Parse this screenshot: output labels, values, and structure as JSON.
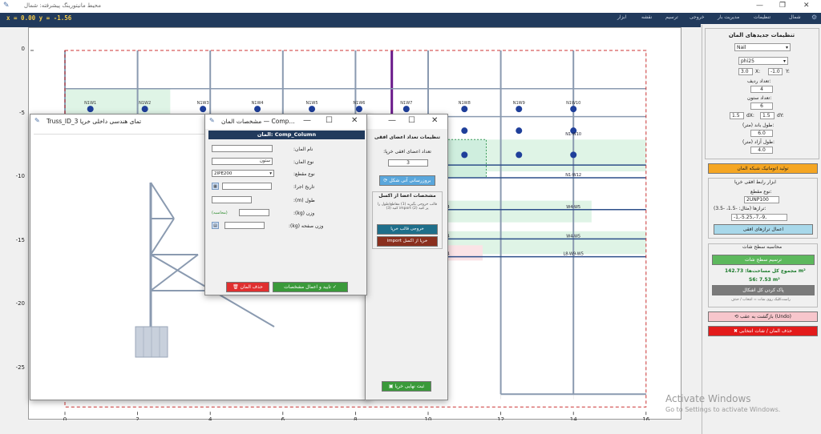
{
  "app": {
    "title": "محیط مانیتورینگ پیشرفته: شمال",
    "menu": [
      "شمال",
      "تنظیمات",
      "مدیریت بار",
      "خروجی",
      "ترسیم",
      "نقشه",
      "ابزار"
    ]
  },
  "coords": {
    "text": "x = 0.00    y = -1.56"
  },
  "plot": {
    "x_ticks": [
      "0",
      "2",
      "4",
      "6",
      "8",
      "10",
      "12",
      "14",
      "16"
    ],
    "y_ticks": [
      "0",
      "-5",
      "-10",
      "-15",
      "-20",
      "-25"
    ],
    "node_labels_row1": [
      "N1W1",
      "N1W2",
      "N1W3",
      "N1W4",
      "N1W5",
      "N1W6",
      "N1W7",
      "N1W8",
      "N1W9",
      "N1W10"
    ],
    "wall_labels": [
      "N1-W10",
      "N1-W12",
      "W4-W5",
      "W4-W5",
      "W4",
      "W4",
      "W4",
      "L8-W9-W5",
      "N1-W12",
      "N1-W10",
      "N1-W9",
      "N2-W3"
    ],
    "colors": {
      "grid_col": "#8a9ab0",
      "beam": "#2d4f8a",
      "node": "#1f3f9a",
      "purple": "#6a1a8a",
      "dash": "#cc3333",
      "green_fill": "#dff4e6",
      "pink_fill": "#fbe3e6"
    }
  },
  "right_panel": {
    "header": "تنظیمات جدیدهای المان",
    "type_select": "Nail",
    "size_select": "phi25",
    "x_val": "3.0",
    "x_lbl": "X:",
    "y_val": "-1.0",
    "y_lbl": "Y:",
    "rows_lbl": "تعداد ردیف:",
    "rows_val": "4",
    "cols_lbl": "تعداد ستون:",
    "cols_val": "6",
    "dx_val": "1.5",
    "dx_lbl": "dX:",
    "dy_val": "1.5",
    "dy_lbl": "dY:",
    "len_lbl": "طول باند (متر):",
    "len_val": "6.0",
    "free_lbl": "طول آزاد (متر):",
    "free_val": "4.0",
    "generate_btn": "تولید اتوماتیک شبکه المان",
    "strut_title": "ابزار رابط افقی خرپا",
    "section_lbl": "نوع مقطع:",
    "section_val": "2UNP100",
    "levels_lbl": "ترازها (مثال: -1.5، -3.5):",
    "levels_val": "-1,-5.25,-7,-9,",
    "apply_btn": "اعمال ترازهای افقی",
    "area_title": "محاسبه سطح شات",
    "draw_area_btn": "ترسیم سطح شات",
    "total_area": "مجموع کل مساحت‌ها: 142.73 m²",
    "s6_area": "S6: 7.53 m²",
    "clear_btn": "پاک کردن کل اشکال",
    "hint": "راست‌کلیک روی شات = انتخاب / حذف",
    "undo_btn": "بازگشت به عقب (Undo)",
    "delete_btn": "حذف المان / شات انتخابی",
    "colors": {
      "generate": "#f5a623",
      "apply": "#a8d8ea",
      "draw": "#5cb85c",
      "clear": "#7a7a7a",
      "undo": "#f7c6cc",
      "delete": "#e31b1b"
    }
  },
  "truss_window": {
    "title": "Truss_ID_3  تمای هندسی داخلی خرپا"
  },
  "horiz_window": {
    "header": "تنظیمات تعداد اعضای افقی",
    "count_lbl": "تعداد اعضای افقی خرپا:",
    "count_val": "3",
    "update_btn": "بروزرسانی آنی شکل",
    "excel_title": "مشخصات اعضا از اکسل",
    "excel_note": "قالب خروجی بگیرید (1) مقاطع/طول را پر کنید (2) import کنید (3)",
    "export_btn": "خروجی قالب خرپا",
    "import_btn": "import خرپا از اکسل",
    "final_btn": "ثبت نهایی خرپا"
  },
  "comp_window": {
    "title": "مشخصات المان — Comp...",
    "header": "المان: Comp_Column",
    "f_name": "نام المان:",
    "f_type": "نوع المان:",
    "type_val": "ستون",
    "f_section": "نوع مقطع:",
    "section_val": "2IPE200",
    "f_date": "تاریخ اجرا:",
    "f_length": "طول (m):",
    "f_weight": "وزن (kg):",
    "weight_calc": "(محاسبه)",
    "f_plate": "وزن صفحه (kg):",
    "confirm_btn": "تایید و اعمال مشخصات ✓",
    "delete_btn": "حذف المان"
  },
  "watermark": {
    "line1": "Activate Windows",
    "line2": "Go to Settings to activate Windows."
  }
}
